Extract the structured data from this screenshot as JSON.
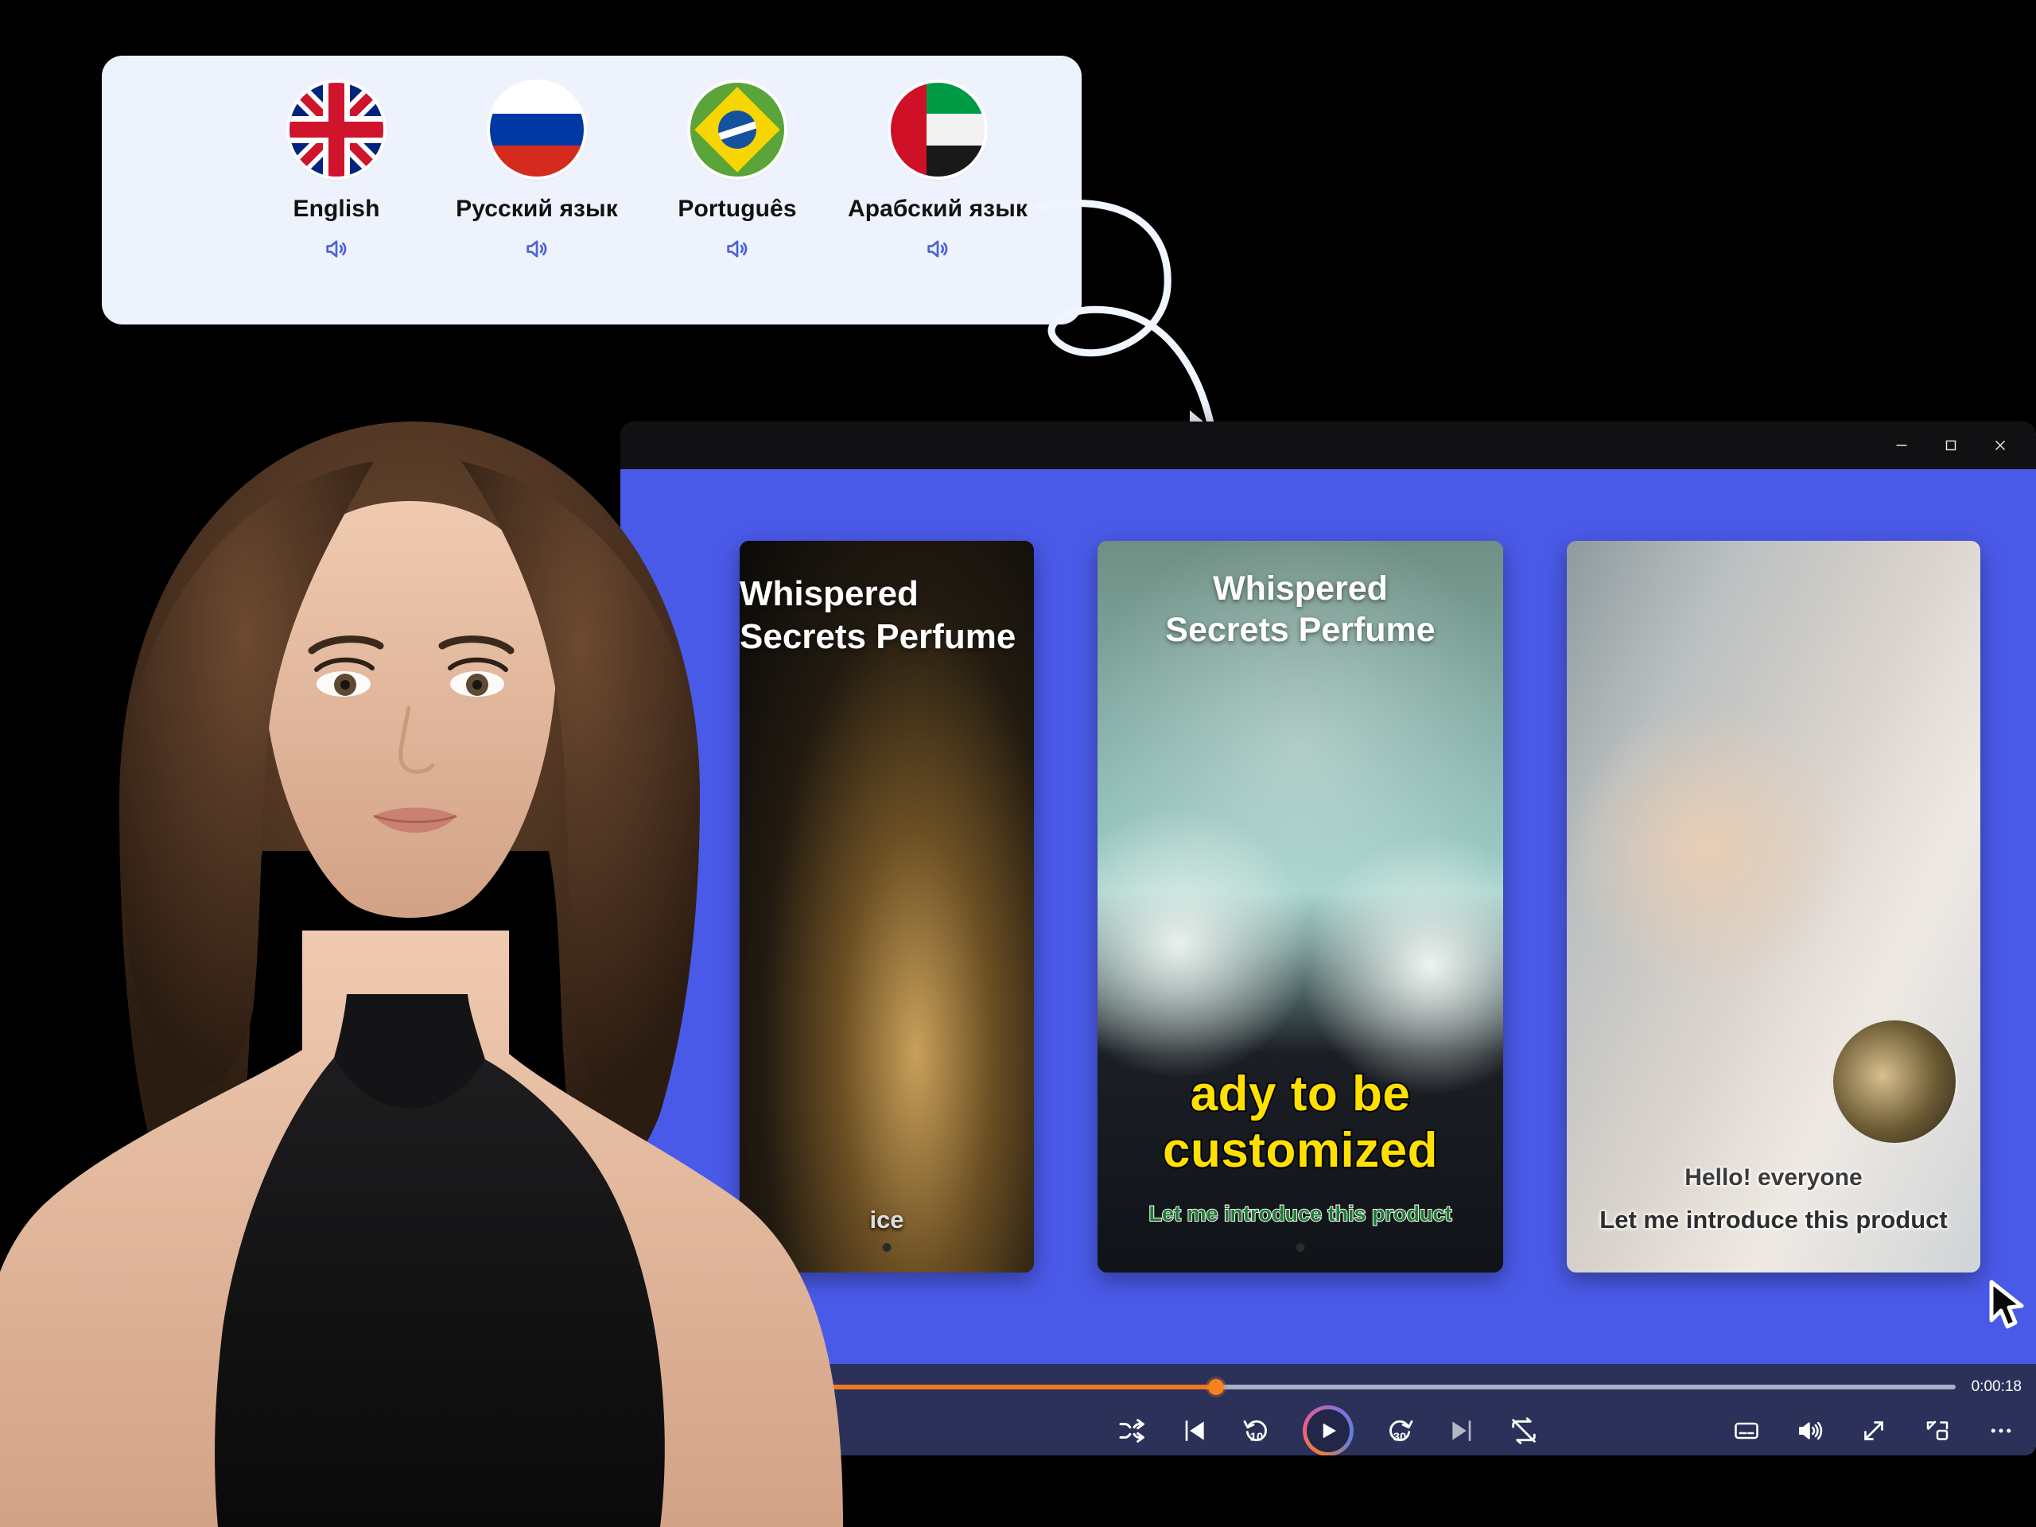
{
  "language_panel": {
    "items": [
      {
        "label": "English",
        "flag": "uk-flag-icon",
        "speaker_icon": "speaker-icon"
      },
      {
        "label": "Русский язык",
        "flag": "russia-flag-icon",
        "speaker_icon": "speaker-icon"
      },
      {
        "label": "Português",
        "flag": "brazil-flag-icon",
        "speaker_icon": "speaker-icon"
      },
      {
        "label": "Арабский язык",
        "flag": "uae-flag-icon",
        "speaker_icon": "speaker-icon"
      }
    ],
    "background_color": "#eef2fd"
  },
  "window": {
    "background_color": "#4a5ae8",
    "titlebar_color": "#111113",
    "controls": {
      "minimize": "minimize-icon",
      "maximize": "maximize-icon",
      "close": "close-icon"
    }
  },
  "cards": {
    "left": {
      "title": "Whispered\nSecrets Perfume",
      "caption": "ice"
    },
    "center": {
      "title_line1": "Whispered",
      "title_line2": "Secrets Perfume",
      "caption_main": "ady to be customized",
      "caption_sub": "Let me introduce this product"
    },
    "right": {
      "caption_line1": "Hello! everyone",
      "caption_line2": "Let me introduce this product"
    }
  },
  "player": {
    "time_label": "0:00:18",
    "progress_percent": 44,
    "accent_color": "#f58220",
    "track_color": "#aab0c7",
    "bar_color": "#2b3159",
    "center_controls": [
      {
        "name": "shuffle-icon",
        "label": "Shuffle"
      },
      {
        "name": "previous-icon",
        "label": "Previous"
      },
      {
        "name": "rewind-10-icon",
        "label": "10"
      },
      {
        "name": "play-icon",
        "label": "Play"
      },
      {
        "name": "forward-30-icon",
        "label": "30"
      },
      {
        "name": "next-icon",
        "label": "Next"
      },
      {
        "name": "repeat-off-icon",
        "label": "Repeat off"
      }
    ],
    "right_controls": [
      {
        "name": "captions-icon",
        "label": "Subtitles"
      },
      {
        "name": "volume-icon",
        "label": "Volume"
      },
      {
        "name": "fullscreen-icon",
        "label": "Fullscreen"
      },
      {
        "name": "picture-in-picture-icon",
        "label": "Picture in picture"
      },
      {
        "name": "more-options-icon",
        "label": "More"
      }
    ]
  },
  "annotations": {
    "arrow": "curved-arrow-icon",
    "cursor": "mouse-cursor-icon"
  }
}
